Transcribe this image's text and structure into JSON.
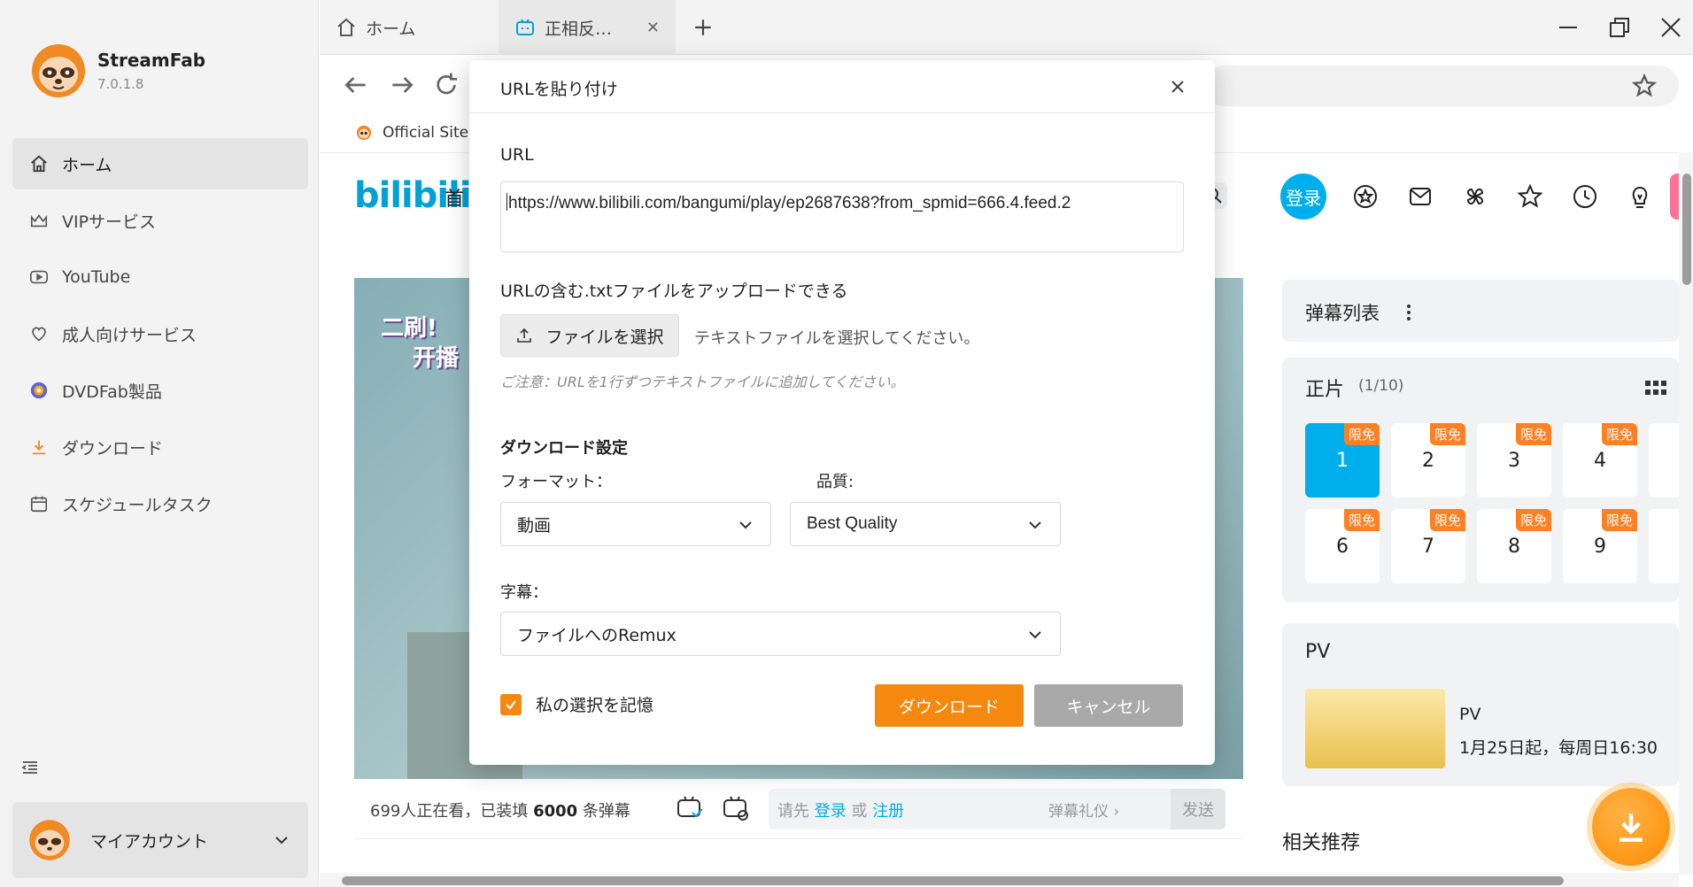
{
  "app": {
    "name": "StreamFab",
    "version": "7.0.1.8"
  },
  "sidebar": {
    "items": [
      {
        "label": "ホーム"
      },
      {
        "label": "VIPサービス"
      },
      {
        "label": "YouTube"
      },
      {
        "label": "成人向けサービス"
      },
      {
        "label": "DVDFab製品"
      },
      {
        "label": "ダウンロード"
      },
      {
        "label": "スケジュールタスク"
      }
    ],
    "account_label": "マイアカウント"
  },
  "tabs": [
    {
      "label": "ホーム"
    },
    {
      "label": "正相反…"
    }
  ],
  "bookmarks": [
    {
      "label": "Official Site"
    }
  ],
  "bilibili": {
    "logo": "bilibili",
    "nav_first": "首",
    "login": "登录",
    "video_caption_1": "二刷!",
    "video_caption_2": "开播",
    "viewers_prefix": "699人正在看，已装填 ",
    "viewers_count": "6000",
    "viewers_suffix": " 条弹幕",
    "dm_hint_pre": "请先 ",
    "dm_login": "登录",
    "dm_or": " 或 ",
    "dm_register": "注册",
    "dm_gift": "弹幕礼仪 ›",
    "dm_send": "发送",
    "danmaku_list": "弹幕列表",
    "episodes_title": "正片",
    "episodes_count": "(1/10)",
    "episode_tag": "限免",
    "episodes": [
      {
        "num": "1",
        "active": true
      },
      {
        "num": "2"
      },
      {
        "num": "3"
      },
      {
        "num": "4"
      },
      {
        "num": "6"
      },
      {
        "num": "7"
      },
      {
        "num": "8"
      },
      {
        "num": "9"
      }
    ],
    "pv_title": "PV",
    "pv_name": "PV",
    "pv_date": "1月25日起，每周日16:30",
    "related": "相关推荐",
    "accent": "#00aeec"
  },
  "dialog": {
    "title": "URLを貼り付け",
    "url_label": "URL",
    "url_value": "https://www.bilibili.com/bangumi/play/ep2687638?from_spmid=666.4.feed.2",
    "upload_label": "URLの含む.txtファイルをアップロードできる",
    "file_button": "ファイルを選択",
    "file_hint": "テキストファイルを選択してください。",
    "file_note": "ご注意：URLを1行ずつテキストファイルに追加してください。",
    "settings_title": "ダウンロード設定",
    "format_label": "フォーマット：",
    "format_value": "動画",
    "quality_label": "品質:",
    "quality_value": "Best Quality",
    "subtitle_label": "字幕：",
    "subtitle_value": "ファイルへのRemux",
    "remember_label": "私の選択を記憶",
    "download_button": "ダウンロード",
    "cancel_button": "キャンセル",
    "accent": "#f5890f"
  }
}
